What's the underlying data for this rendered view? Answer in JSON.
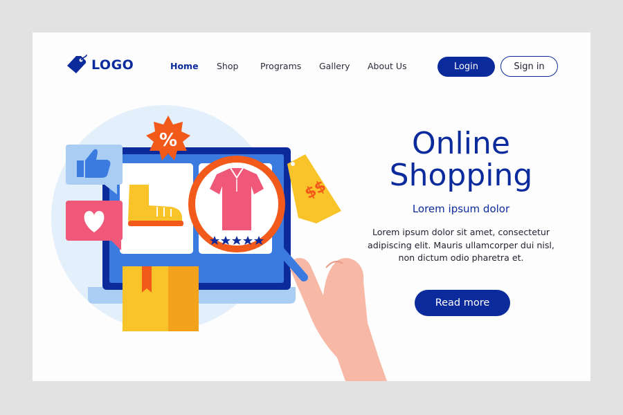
{
  "header": {
    "logo_text": "LOGO",
    "nav": [
      {
        "label": "Home",
        "active": true
      },
      {
        "label": "Shop",
        "active": false
      },
      {
        "label": "Programs",
        "active": false
      },
      {
        "label": "Gallery",
        "active": false
      },
      {
        "label": "About Us",
        "active": false
      }
    ],
    "login_label": "Login",
    "signin_label": "Sign in"
  },
  "hero": {
    "title_line1": "Online",
    "title_line2": "Shopping",
    "subtitle": "Lorem ipsum dolor",
    "body": "Lorem ipsum dolor sit amet, consectetur adipiscing elit. Mauris ullamcorper dui nisl, non dictum odio pharetra et.",
    "cta_label": "Read more"
  },
  "illustration": {
    "percent_badge": "%",
    "price_tag": "$$",
    "rating_stars": 5,
    "icons": [
      "thumbs-up-icon",
      "heart-icon",
      "percent-badge-icon",
      "price-tag-icon",
      "magnifier-icon",
      "tshirt-icon",
      "boot-icon",
      "package-icon",
      "hand-icon",
      "laptop-icon"
    ]
  },
  "colors": {
    "brand": "#0b2a9c",
    "background": "#fdfdfd",
    "frame": "#e2e2e2",
    "accent_orange": "#f25a1b",
    "accent_yellow": "#f9c32a",
    "accent_pink": "#f0587a",
    "skin": "#f7b9a6",
    "light_blue": "#e3effb"
  }
}
